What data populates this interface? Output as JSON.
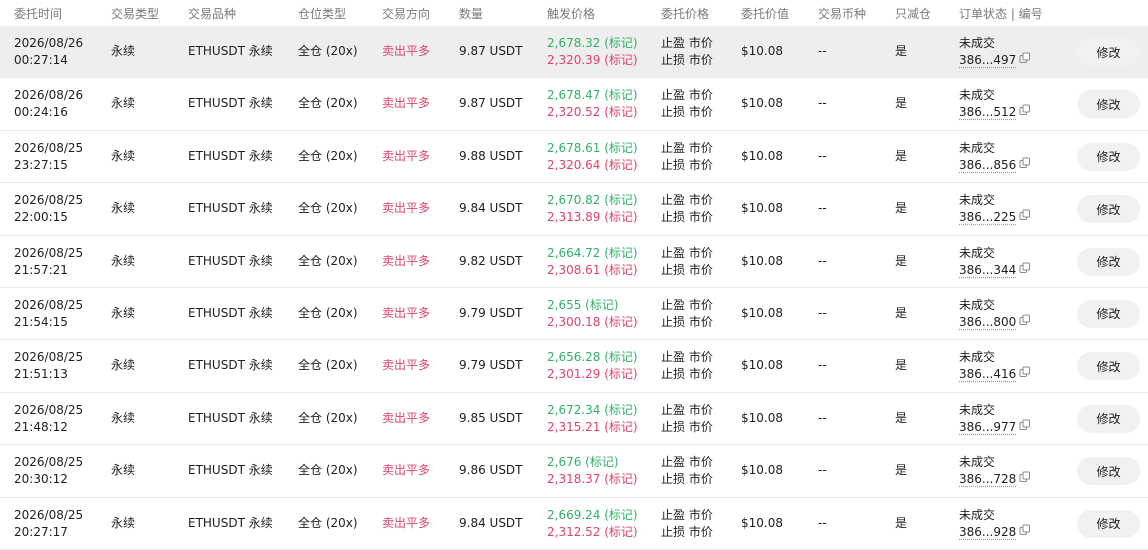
{
  "headers": {
    "time": "委托时间",
    "type": "交易类型",
    "symbol": "交易品种",
    "margin": "仓位类型",
    "side": "交易方向",
    "qty": "数量",
    "trigger": "触发价格",
    "order_price": "委托价格",
    "order_value": "委托价值",
    "currency": "交易币种",
    "reduce_only": "只减仓",
    "status_id": "订单状态 | 编号"
  },
  "rows": [
    {
      "date": "2026/08/26",
      "time": "00:27:14",
      "type": "永续",
      "symbol": "ETHUSDT 永续",
      "margin": "全仓 (20x)",
      "side": "卖出平多",
      "qty": "9.87 USDT",
      "tp": "2,678.32 (标记)",
      "sl": "2,320.39 (标记)",
      "tp_price": "止盈 市价",
      "sl_price": "止损 市价",
      "value": "$10.08",
      "currency": "--",
      "reduce": "是",
      "status": "未成交",
      "id": "386...497",
      "edit": "修改"
    },
    {
      "date": "2026/08/26",
      "time": "00:24:16",
      "type": "永续",
      "symbol": "ETHUSDT 永续",
      "margin": "全仓 (20x)",
      "side": "卖出平多",
      "qty": "9.87 USDT",
      "tp": "2,678.47 (标记)",
      "sl": "2,320.52 (标记)",
      "tp_price": "止盈 市价",
      "sl_price": "止损 市价",
      "value": "$10.08",
      "currency": "--",
      "reduce": "是",
      "status": "未成交",
      "id": "386...512",
      "edit": "修改"
    },
    {
      "date": "2026/08/25",
      "time": "23:27:15",
      "type": "永续",
      "symbol": "ETHUSDT 永续",
      "margin": "全仓 (20x)",
      "side": "卖出平多",
      "qty": "9.88 USDT",
      "tp": "2,678.61 (标记)",
      "sl": "2,320.64 (标记)",
      "tp_price": "止盈 市价",
      "sl_price": "止损 市价",
      "value": "$10.08",
      "currency": "--",
      "reduce": "是",
      "status": "未成交",
      "id": "386...856",
      "edit": "修改"
    },
    {
      "date": "2026/08/25",
      "time": "22:00:15",
      "type": "永续",
      "symbol": "ETHUSDT 永续",
      "margin": "全仓 (20x)",
      "side": "卖出平多",
      "qty": "9.84 USDT",
      "tp": "2,670.82 (标记)",
      "sl": "2,313.89 (标记)",
      "tp_price": "止盈 市价",
      "sl_price": "止损 市价",
      "value": "$10.08",
      "currency": "--",
      "reduce": "是",
      "status": "未成交",
      "id": "386...225",
      "edit": "修改"
    },
    {
      "date": "2026/08/25",
      "time": "21:57:21",
      "type": "永续",
      "symbol": "ETHUSDT 永续",
      "margin": "全仓 (20x)",
      "side": "卖出平多",
      "qty": "9.82 USDT",
      "tp": "2,664.72 (标记)",
      "sl": "2,308.61 (标记)",
      "tp_price": "止盈 市价",
      "sl_price": "止损 市价",
      "value": "$10.08",
      "currency": "--",
      "reduce": "是",
      "status": "未成交",
      "id": "386...344",
      "edit": "修改"
    },
    {
      "date": "2026/08/25",
      "time": "21:54:15",
      "type": "永续",
      "symbol": "ETHUSDT 永续",
      "margin": "全仓 (20x)",
      "side": "卖出平多",
      "qty": "9.79 USDT",
      "tp": "2,655 (标记)",
      "sl": "2,300.18 (标记)",
      "tp_price": "止盈 市价",
      "sl_price": "止损 市价",
      "value": "$10.08",
      "currency": "--",
      "reduce": "是",
      "status": "未成交",
      "id": "386...800",
      "edit": "修改"
    },
    {
      "date": "2026/08/25",
      "time": "21:51:13",
      "type": "永续",
      "symbol": "ETHUSDT 永续",
      "margin": "全仓 (20x)",
      "side": "卖出平多",
      "qty": "9.79 USDT",
      "tp": "2,656.28 (标记)",
      "sl": "2,301.29 (标记)",
      "tp_price": "止盈 市价",
      "sl_price": "止损 市价",
      "value": "$10.08",
      "currency": "--",
      "reduce": "是",
      "status": "未成交",
      "id": "386...416",
      "edit": "修改"
    },
    {
      "date": "2026/08/25",
      "time": "21:48:12",
      "type": "永续",
      "symbol": "ETHUSDT 永续",
      "margin": "全仓 (20x)",
      "side": "卖出平多",
      "qty": "9.85 USDT",
      "tp": "2,672.34 (标记)",
      "sl": "2,315.21 (标记)",
      "tp_price": "止盈 市价",
      "sl_price": "止损 市价",
      "value": "$10.08",
      "currency": "--",
      "reduce": "是",
      "status": "未成交",
      "id": "386...977",
      "edit": "修改"
    },
    {
      "date": "2026/08/25",
      "time": "20:30:12",
      "type": "永续",
      "symbol": "ETHUSDT 永续",
      "margin": "全仓 (20x)",
      "side": "卖出平多",
      "qty": "9.86 USDT",
      "tp": "2,676 (标记)",
      "sl": "2,318.37 (标记)",
      "tp_price": "止盈 市价",
      "sl_price": "止损 市价",
      "value": "$10.08",
      "currency": "--",
      "reduce": "是",
      "status": "未成交",
      "id": "386...728",
      "edit": "修改"
    },
    {
      "date": "2026/08/25",
      "time": "20:27:17",
      "type": "永续",
      "symbol": "ETHUSDT 永续",
      "margin": "全仓 (20x)",
      "side": "卖出平多",
      "qty": "9.84 USDT",
      "tp": "2,669.24 (标记)",
      "sl": "2,312.52 (标记)",
      "tp_price": "止盈 市价",
      "sl_price": "止损 市价",
      "value": "$10.08",
      "currency": "--",
      "reduce": "是",
      "status": "未成交",
      "id": "386...928",
      "edit": "修改"
    }
  ],
  "colors": {
    "sell": "#e0436b",
    "take_profit": "#31b06a",
    "stop_loss": "#e0436b",
    "row_highlight": "#eeeeee"
  },
  "icons": {
    "copy": "copy-icon"
  }
}
